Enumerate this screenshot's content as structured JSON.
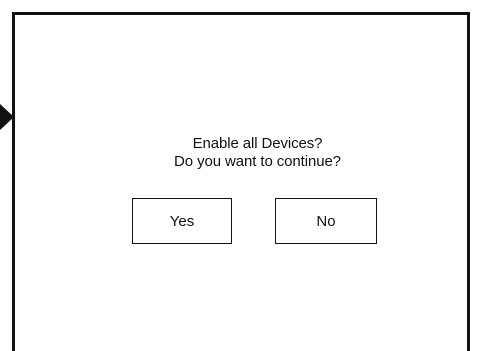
{
  "dialog": {
    "message_line1": "Enable all Devices?",
    "message_line2": "Do you want to continue?",
    "yes_label": "Yes",
    "no_label": "No"
  },
  "icons": {
    "pointer": "triangle-pointer-right-icon"
  },
  "colors": {
    "border": "#111111",
    "background": "#ffffff",
    "text": "#111111"
  }
}
